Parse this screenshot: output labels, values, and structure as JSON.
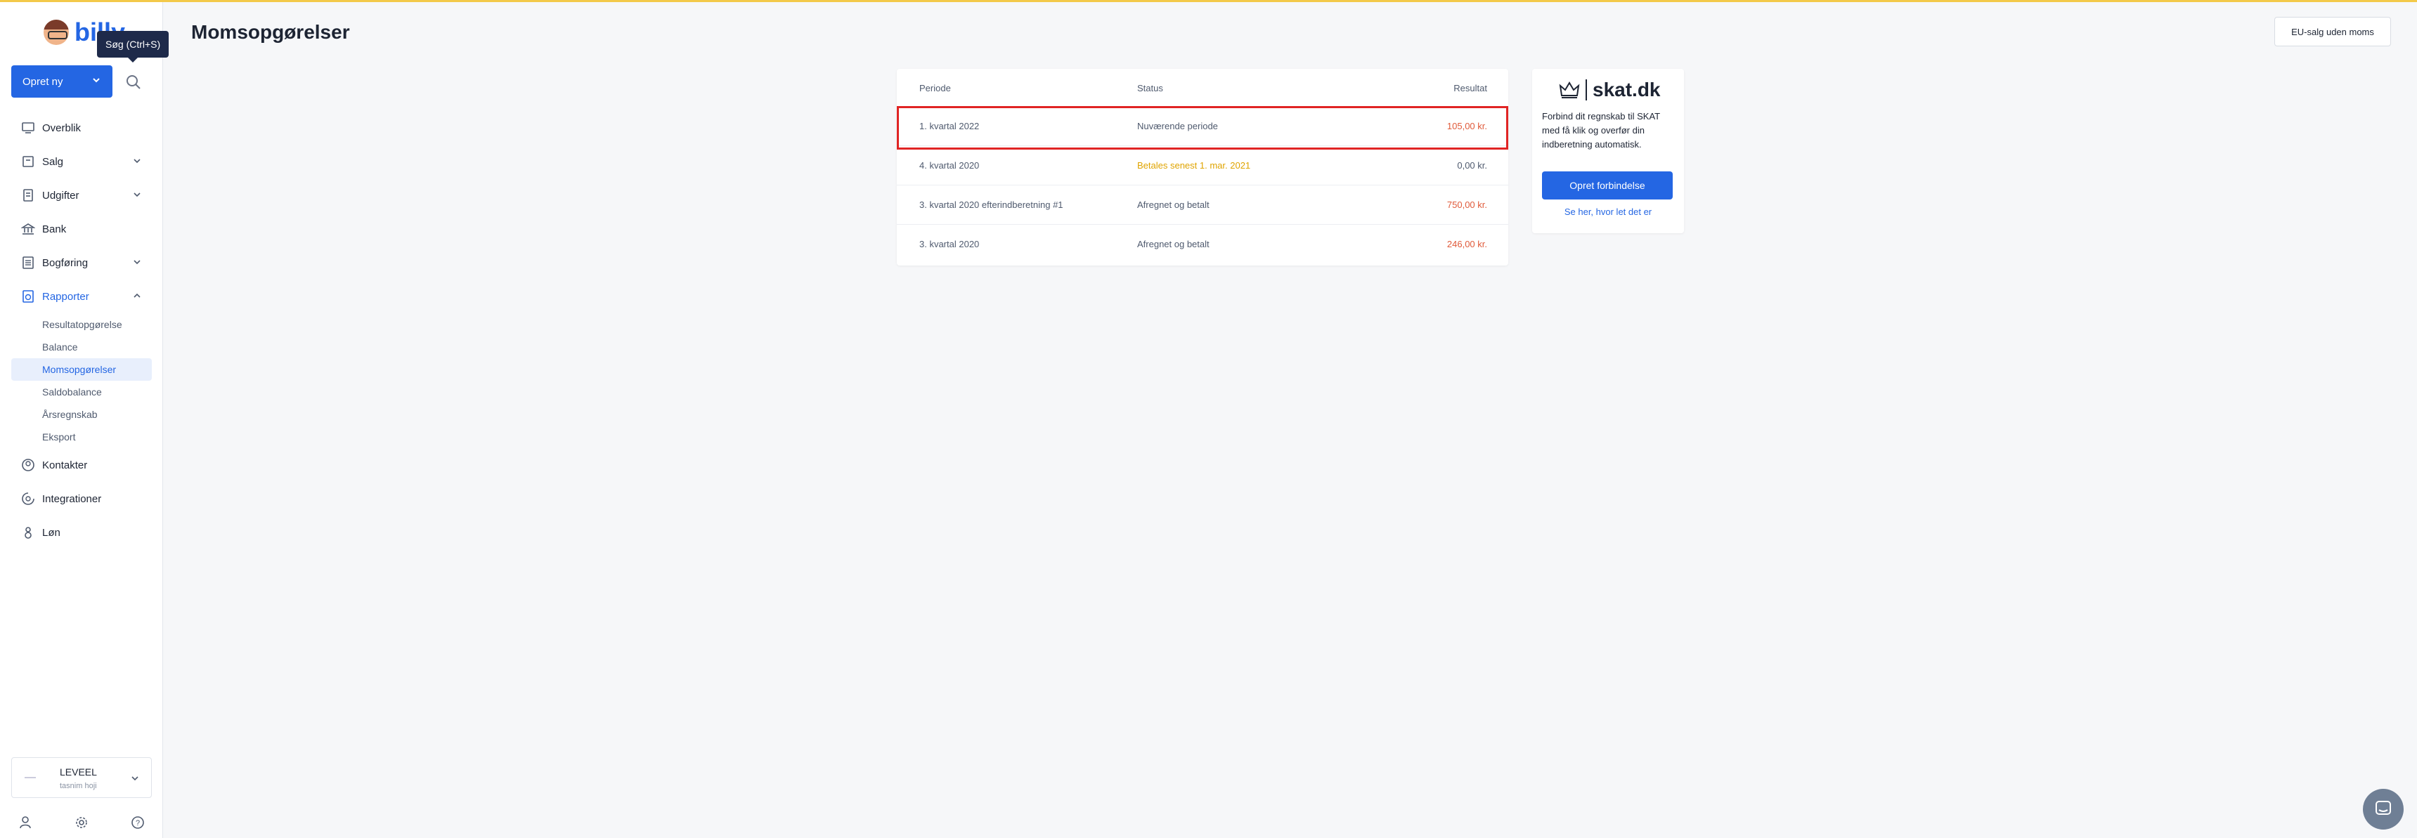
{
  "app": {
    "logo_text": "billy",
    "tooltip": "Søg (Ctrl+S)",
    "create_button": "Opret ny",
    "brand_color": "#2466e3"
  },
  "sidebar": {
    "items": [
      {
        "label": "Overblik",
        "icon": "dashboard-icon"
      },
      {
        "label": "Salg",
        "icon": "sales-icon"
      },
      {
        "label": "Udgifter",
        "icon": "expenses-icon"
      },
      {
        "label": "Bank",
        "icon": "bank-icon"
      },
      {
        "label": "Bogføring",
        "icon": "ledger-icon"
      },
      {
        "label": "Rapporter",
        "icon": "reports-icon"
      },
      {
        "label": "Kontakter",
        "icon": "contacts-icon"
      },
      {
        "label": "Integrationer",
        "icon": "integrations-icon"
      },
      {
        "label": "Løn",
        "icon": "payroll-icon"
      }
    ],
    "reports_sub": [
      {
        "label": "Resultatopgørelse"
      },
      {
        "label": "Balance"
      },
      {
        "label": "Momsopgørelser"
      },
      {
        "label": "Saldobalance"
      },
      {
        "label": "Årsregnskab"
      },
      {
        "label": "Eksport"
      }
    ],
    "org": {
      "name": "LEVEEL",
      "user": "tasnim hoji"
    }
  },
  "page": {
    "title": "Momsopgørelser",
    "eu_button": "EU-salg uden moms"
  },
  "vat_table": {
    "headers": {
      "period": "Periode",
      "status": "Status",
      "result": "Resultat"
    },
    "rows": [
      {
        "period": "1. kvartal 2022",
        "status": "Nuværende periode",
        "result": "105,00 kr.",
        "result_color": "#e05a3a"
      },
      {
        "period": "4. kvartal 2020",
        "status": "Betales senest 1. mar. 2021",
        "result": "0,00 kr.",
        "result_color": "#4f5a6e"
      },
      {
        "period": "3. kvartal 2020 efterindberetning #1",
        "status": "Afregnet og betalt",
        "result": "750,00 kr.",
        "result_color": "#e05a3a"
      },
      {
        "period": "3. kvartal 2020",
        "status": "Afregnet og betalt",
        "result": "246,00 kr.",
        "result_color": "#e05a3a"
      }
    ]
  },
  "skat_card": {
    "logo": "skat.dk",
    "text": "Forbind dit regnskab til SKAT med få klik og overfør din indberetning automatisk.",
    "button": "Opret forbindelse",
    "link": "Se her, hvor let det er"
  }
}
